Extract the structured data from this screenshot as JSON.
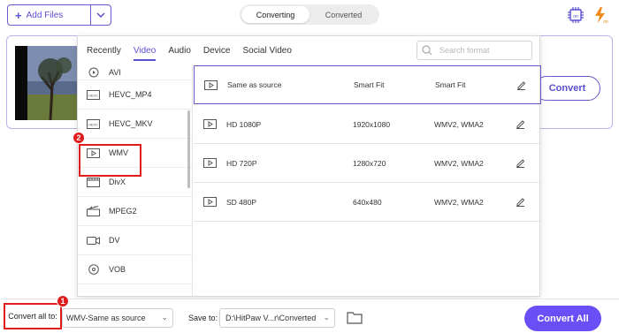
{
  "toolbar": {
    "add_files_label": "Add Files",
    "mode_tabs": [
      "Converting",
      "Converted"
    ],
    "active_mode": "Converting"
  },
  "file_card": {
    "convert_label": "Convert"
  },
  "popup": {
    "category_tabs": [
      "Recently",
      "Video",
      "Audio",
      "Device",
      "Social Video"
    ],
    "active_category": "Video",
    "search_placeholder": "Search format",
    "formats": [
      {
        "label": "AVI",
        "icon": "play-file-icon"
      },
      {
        "label": "HEVC_MP4",
        "icon": "hevc-icon"
      },
      {
        "label": "HEVC_MKV",
        "icon": "hevc-icon"
      },
      {
        "label": "WMV",
        "icon": "play-file-icon"
      },
      {
        "label": "DivX",
        "icon": "film-icon"
      },
      {
        "label": "MPEG2",
        "icon": "clapper-icon"
      },
      {
        "label": "DV",
        "icon": "camera-icon"
      },
      {
        "label": "VOB",
        "icon": "disc-icon"
      }
    ],
    "selected_format": "WMV",
    "resolutions": [
      {
        "name": "Same as source",
        "resolution": "Smart Fit",
        "audio": "Smart Fit"
      },
      {
        "name": "HD 1080P",
        "resolution": "1920x1080",
        "audio": "WMV2, WMA2"
      },
      {
        "name": "HD 720P",
        "resolution": "1280x720",
        "audio": "WMV2, WMA2"
      },
      {
        "name": "SD 480P",
        "resolution": "640x480",
        "audio": "WMV2, WMA2"
      }
    ]
  },
  "bottom": {
    "convert_all_to_label": "Convert all to:",
    "format_value": "WMV-Same as source",
    "save_to_label": "Save to:",
    "save_path": "D:\\HitPaw V...r\\Converted",
    "convert_all_label": "Convert All"
  },
  "annotations": {
    "marker1": "1",
    "marker2": "2"
  },
  "colors": {
    "accent": "#5b4fd1",
    "primary_button": "#6a4ff6",
    "highlight": "#e01b1b",
    "icon_orange": "#f08a1c"
  }
}
